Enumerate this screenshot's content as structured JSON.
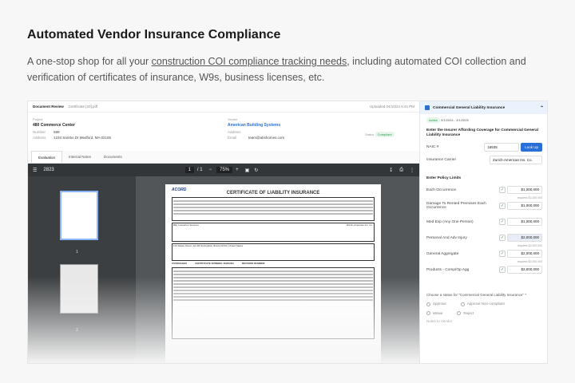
{
  "hero": {
    "title": "Automated Vendor Insurance Compliance",
    "sub_before": "A one-stop shop for all your ",
    "sub_link": "construction COI compliance tracking needs",
    "sub_after": ", including automated COI collection and verification of certificates of insurance, W9s, business licenses, etc."
  },
  "doc_header": {
    "title": "Document Review",
    "file": "Certificate [20].pdf",
    "uploaded": "Uploaded 04/10/24 6:41 PM"
  },
  "project": {
    "label": "Project",
    "name": "480 Commerce Center",
    "number_label": "Number",
    "number": "589",
    "address_label": "Address",
    "address": "1234 Sambo Dr Medford, MA 02155"
  },
  "vendor": {
    "label": "Vendor",
    "name": "American Building Systems",
    "address_label": "Address",
    "email_label": "Email",
    "email": "team@abshomes.com",
    "status_label": "Status",
    "status": "Compliant"
  },
  "tabs": [
    "Evaluation",
    "Internal Notes",
    "Documents"
  ],
  "viewer": {
    "doc_id": "2823",
    "page": "1",
    "page_total": "/ 1",
    "zoom": "75%",
    "thumb1": "1",
    "thumb2": "2",
    "form_title": "CERTIFICATE OF LIABILITY INSURANCE",
    "logo": "ACORD",
    "producer": "Billy Insurance Services",
    "insured": "123 Maple Street, Apt 4B Springfield, Illinois 62704, United States",
    "insurer_a": "Zurich-American Ins. Co.",
    "coverages": "COVERAGES",
    "cert_no": "CERTIFICATE NUMBER: 30231001",
    "revision": "REVISION NUMBER:"
  },
  "panel": {
    "title": "Commercial General Liability Insurance",
    "status": "Active",
    "dates": "3/1/2024 - 3/1/2025",
    "insurer_heading": "Enter the Insurer Affording Coverage for Commercial General Liability Insurance",
    "naic_label": "NAIC #",
    "naic": "16535",
    "lookup": "Look Up",
    "carrier_label": "Insurance Carrier",
    "carrier": "Zurich-American Ins. Co.",
    "limits_heading": "Enter Policy Limits",
    "limits": [
      {
        "label": "Each Occurrence",
        "value": "$1,000,000",
        "req": "requires $1,000,000",
        "hl": false
      },
      {
        "label": "Damage To Rented Premises Each Occurrence",
        "value": "$1,000,000",
        "req": "",
        "hl": false
      },
      {
        "label": "Med Exp (Any One Person)",
        "value": "$1,000,000",
        "req": "",
        "hl": false
      },
      {
        "label": "Personal And Adv Injury",
        "value": "$2,000,000",
        "req": "requires $1,000,000",
        "hl": true
      },
      {
        "label": "General Aggregate",
        "value": "$2,000,000",
        "req": "requires $2,000,000",
        "hl": false
      },
      {
        "label": "Products - Comp/Op Agg",
        "value": "$2,000,000",
        "req": "",
        "hl": false
      }
    ],
    "status_prompt": "Choose a status for \"Commercial General Liability Insurance\" *",
    "opt_approve": "Approve",
    "opt_approve_nc": "Approve Non-compliant",
    "opt_waive": "Waive",
    "opt_reject": "Reject",
    "notes_label": "Notes to Vendor"
  }
}
